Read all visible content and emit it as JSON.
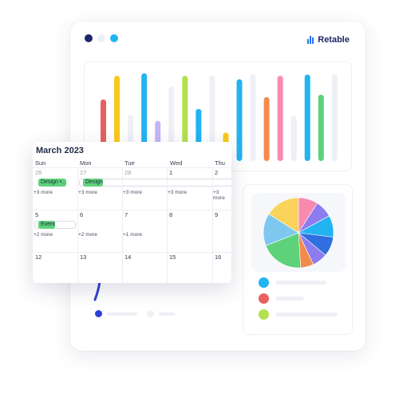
{
  "app": {
    "name": "Retable"
  },
  "window_dots": [
    "#1d2667",
    "#eef0f6",
    "#22b3f1"
  ],
  "bar_chart": {
    "series": [
      {
        "value": 0.52,
        "color": "#e8605e"
      },
      {
        "value": 0.72,
        "color": "#f9c81a"
      },
      {
        "value": 0.39,
        "color": "#eef0f6"
      },
      {
        "value": 0.74,
        "color": "#22b3f1"
      },
      {
        "value": 0.34,
        "color": "#c4b5f7"
      },
      {
        "value": 0.63,
        "color": "#eef0f6"
      },
      {
        "value": 0.72,
        "color": "#b4e04f"
      },
      {
        "value": 0.44,
        "color": "#22b3f1"
      },
      {
        "value": 0.72,
        "color": "#eef0f6"
      },
      {
        "value": 0.24,
        "color": "#f9c81a"
      },
      {
        "value": 0.69,
        "color": "#22b3f1"
      },
      {
        "value": 0.73,
        "color": "#eef0f6"
      },
      {
        "value": 0.54,
        "color": "#f28b4c"
      },
      {
        "value": 0.72,
        "color": "#f88ab0"
      },
      {
        "value": 0.38,
        "color": "#eef0f6"
      },
      {
        "value": 0.73,
        "color": "#22b3f1"
      },
      {
        "value": 0.56,
        "color": "#5ed27b"
      },
      {
        "value": 0.73,
        "color": "#eef0f6"
      }
    ]
  },
  "pie_chart": {
    "slices": [
      {
        "value": 9,
        "color": "#f88ab0"
      },
      {
        "value": 8,
        "color": "#8d7cf0"
      },
      {
        "value": 10,
        "color": "#22b3f1"
      },
      {
        "value": 9,
        "color": "#2f6fe0"
      },
      {
        "value": 7,
        "color": "#8d7cf0"
      },
      {
        "value": 6,
        "color": "#f28b4c"
      },
      {
        "value": 20,
        "color": "#5ed27b"
      },
      {
        "value": 15,
        "color": "#7ec8f0"
      },
      {
        "value": 16,
        "color": "#f9d35a"
      }
    ],
    "legend": [
      {
        "color": "#22b3f1"
      },
      {
        "color": "#e8605e"
      },
      {
        "color": "#b4e04f"
      }
    ]
  },
  "footer_legend": [
    {
      "color": "#2f3fd6"
    },
    {
      "color": "#eef0f6"
    }
  ],
  "calendar": {
    "title": "March 2023",
    "weekdays": [
      "Sun",
      "Mon",
      "Tue",
      "Wed",
      "Thu"
    ],
    "weeks": [
      [
        {
          "day": "26",
          "muted": true,
          "more": "+3 more",
          "events": [
            "Design •..."
          ]
        },
        {
          "day": "27",
          "muted": true,
          "more": "+3 more",
          "events": [
            "Design"
          ]
        },
        {
          "day": "28",
          "muted": true,
          "more": "+3 more",
          "events": []
        },
        {
          "day": "1",
          "muted": false,
          "more": "+3 more",
          "events": []
        },
        {
          "day": "2",
          "muted": false,
          "more": "+3 more",
          "events": []
        }
      ],
      [
        {
          "day": "5",
          "muted": false,
          "more": "+2 more",
          "events": [
            "Event"
          ]
        },
        {
          "day": "6",
          "muted": false,
          "more": "+2 more",
          "events": []
        },
        {
          "day": "7",
          "muted": false,
          "more": "+1 more",
          "events": []
        },
        {
          "day": "8",
          "muted": false,
          "more": "",
          "events": []
        },
        {
          "day": "9",
          "muted": false,
          "more": "",
          "events": []
        }
      ],
      [
        {
          "day": "12",
          "muted": false,
          "more": "",
          "events": []
        },
        {
          "day": "13",
          "muted": false,
          "more": "",
          "events": []
        },
        {
          "day": "14",
          "muted": false,
          "more": "",
          "events": []
        },
        {
          "day": "15",
          "muted": false,
          "more": "",
          "events": []
        },
        {
          "day": "16",
          "muted": false,
          "more": "",
          "events": []
        }
      ]
    ]
  }
}
